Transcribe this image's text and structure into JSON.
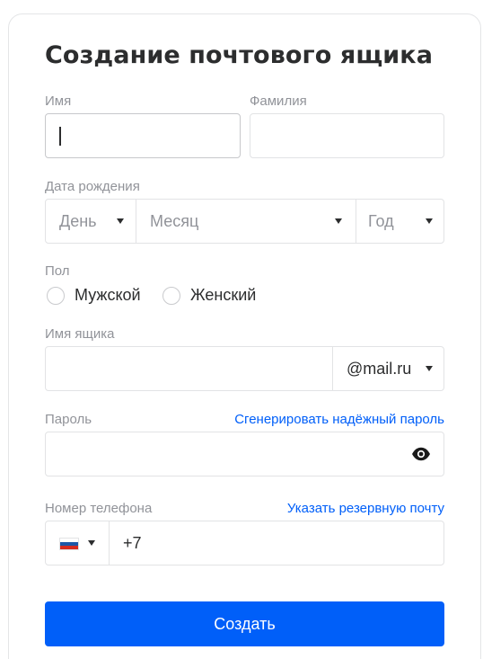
{
  "form": {
    "title": "Создание почтового ящика",
    "first_name": {
      "label": "Имя",
      "value": ""
    },
    "last_name": {
      "label": "Фамилия",
      "value": ""
    },
    "birth": {
      "label": "Дата рождения",
      "day": "День",
      "month": "Месяц",
      "year": "Год"
    },
    "gender": {
      "label": "Пол",
      "male": "Мужской",
      "female": "Женский"
    },
    "mailbox": {
      "label": "Имя ящика",
      "value": "",
      "domain": "@mail.ru"
    },
    "password": {
      "label": "Пароль",
      "generate_link": "Сгенерировать надёжный пароль",
      "value": ""
    },
    "phone": {
      "label": "Номер телефона",
      "backup_link": "Указать резервную почту",
      "value": "+7"
    },
    "submit_label": "Создать"
  },
  "colors": {
    "accent": "#005ff9",
    "label": "#919399",
    "text": "#2c2d2e"
  },
  "icons": {
    "eye": "eye-icon",
    "flag": "russia-flag-icon"
  }
}
